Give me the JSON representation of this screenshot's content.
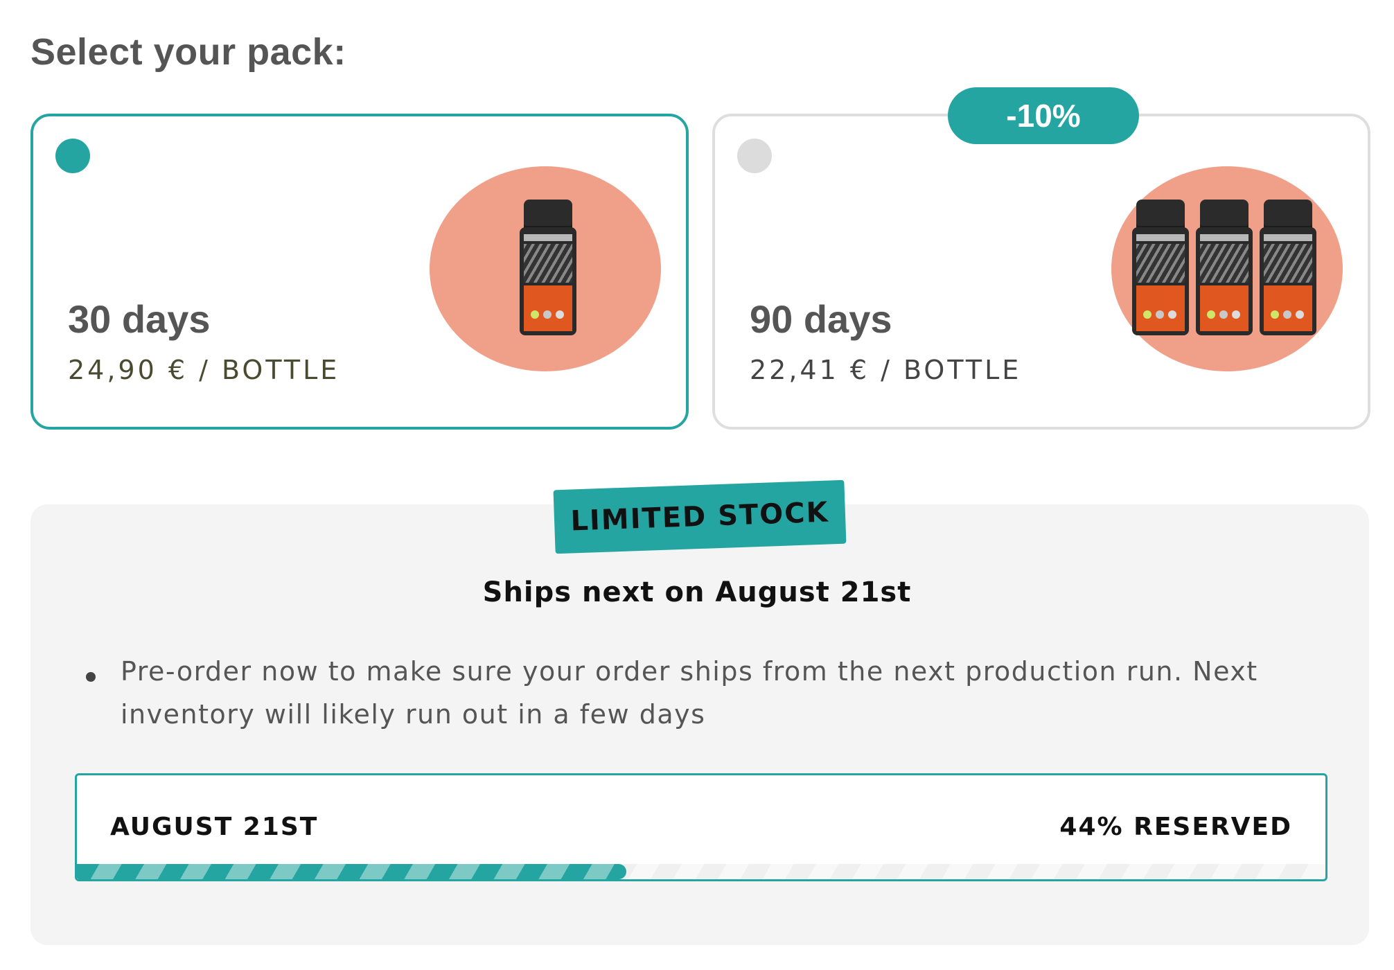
{
  "heading": "Select your pack:",
  "packs": [
    {
      "title": "30 days",
      "price": "24,90 € / BOTTLE",
      "selected": true,
      "bottles": 1
    },
    {
      "title": "90 days",
      "price": "22,41 € / BOTTLE",
      "selected": false,
      "bottles": 3,
      "badge": "-10%"
    }
  ],
  "stock": {
    "badge": "LIMITED STOCK",
    "ships_next": "Ships next on August 21st",
    "note": "Pre-order now to make sure your order ships from the next production run. Next inventory will likely run out in a few days",
    "progress": {
      "date_label": "AUGUST 21ST",
      "reserved_label": "44% RESERVED",
      "reserved_percent": 44
    }
  },
  "colors": {
    "accent": "#25a5a2",
    "product_blob": "#f0a088",
    "panel_bg": "#f4f4f4",
    "unselected_border": "#dedede"
  }
}
